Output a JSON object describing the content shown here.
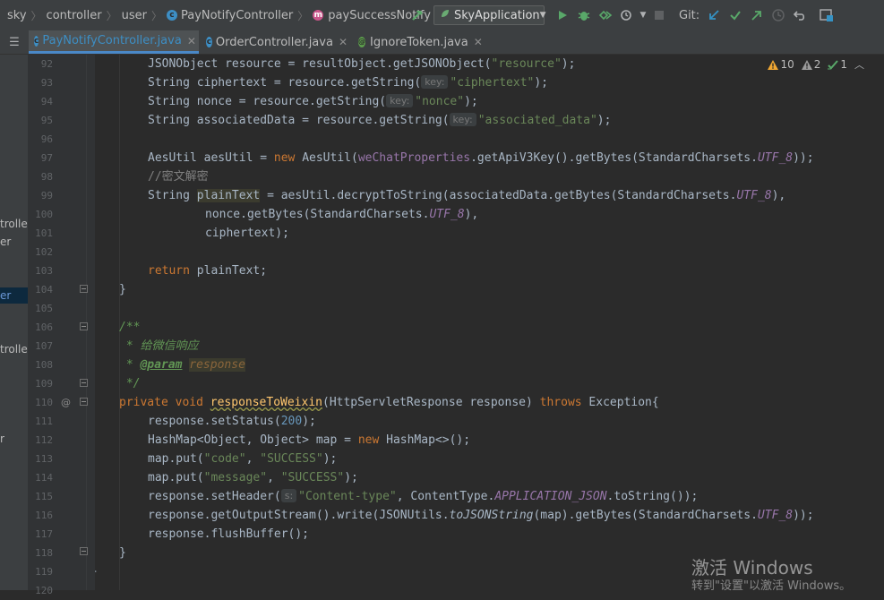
{
  "breadcrumb": {
    "items": [
      "sky",
      "controller",
      "user",
      "PayNotifyController",
      "paySuccessNotify"
    ]
  },
  "toolbar": {
    "run_config": "SkyApplication",
    "git_label": "Git:"
  },
  "tabs": [
    {
      "label": "PayNotifyController.java",
      "active": true
    },
    {
      "label": "OrderController.java",
      "active": false
    },
    {
      "label": "IgnoreToken.java",
      "active": false
    }
  ],
  "inspections": {
    "warnings": "10",
    "weak_warnings": "2",
    "typos": "1"
  },
  "project_panel": [
    "troller",
    "er",
    "er",
    "troller",
    "r"
  ],
  "line_numbers": [
    "92",
    "93",
    "94",
    "95",
    "96",
    "97",
    "98",
    "99",
    "100",
    "101",
    "102",
    "103",
    "104",
    "105",
    "106",
    "107",
    "108",
    "109",
    "110",
    "111",
    "112",
    "113",
    "114",
    "115",
    "116",
    "117",
    "118",
    "119",
    "120"
  ],
  "code": {
    "l92_a": "JSONObject resource = resultObject.getJSONObject(",
    "l92_s": "\"resource\"",
    "l92_b": ");",
    "l93_a": "String ciphertext = resource.getString(",
    "l93_h": "key:",
    "l93_s": "\"ciphertext\"",
    "l93_b": ");",
    "l94_a": "String nonce = resource.getString(",
    "l94_h": "key:",
    "l94_s": "\"nonce\"",
    "l94_b": ");",
    "l95_a": "String associatedData = resource.getString(",
    "l95_h": "key:",
    "l95_s": "\"associated_data\"",
    "l95_b": ");",
    "l97_a": "AesUtil aesUtil = ",
    "l97_kw": "new",
    "l97_b": " AesUtil(",
    "l97_f": "weChatProperties",
    "l97_c": ".getApiV3Key().getBytes(StandardCharsets.",
    "l97_u": "UTF_8",
    "l97_d": "));",
    "l98": "//密文解密",
    "l99_a": "String ",
    "l99_v": "plainText",
    "l99_b": " = aesUtil.decryptToString(associatedData.getBytes(StandardCharsets.",
    "l99_u": "UTF_8",
    "l99_c": "),",
    "l100_a": "nonce.getBytes(StandardCharsets.",
    "l100_u": "UTF_8",
    "l100_b": "),",
    "l101": "ciphertext);",
    "l103_kw": "return",
    "l103_b": " plainText;",
    "l104": "}",
    "l106": "/**",
    "l107": " * 给微信响应",
    "l108_a": " * ",
    "l108_tag": "@param",
    "l108_p": "response",
    "l109": " */",
    "l110_kw1": "private",
    "l110_kw2": "void",
    "l110_m": "responseToWeixin",
    "l110_b": "(HttpServletResponse response) ",
    "l110_kw3": "throws",
    "l110_c": " Exception{",
    "l111_a": "response.setStatus(",
    "l111_n": "200",
    "l111_b": ");",
    "l112_a": "HashMap<Object, Object> map = ",
    "l112_kw": "new",
    "l112_b": " HashMap<>();",
    "l113_a": "map.put(",
    "l113_s1": "\"code\"",
    "l113_m": ", ",
    "l113_s2": "\"SUCCESS\"",
    "l113_b": ");",
    "l114_a": "map.put(",
    "l114_s1": "\"message\"",
    "l114_m": ", ",
    "l114_s2": "\"SUCCESS\"",
    "l114_b": ");",
    "l115_a": "response.setHeader(",
    "l115_h": "s:",
    "l115_s": "\"Content-type\"",
    "l115_b": ", ContentType.",
    "l115_f": "APPLICATION_JSON",
    "l115_c": ".toString());",
    "l116_a": "response.getOutputStream().write(JSONUtils.",
    "l116_i": "toJSONString",
    "l116_b": "(map).getBytes(StandardCharsets.",
    "l116_u": "UTF_8",
    "l116_c": "));",
    "l117": "response.flushBuffer();",
    "l118": "}",
    "l119": "}"
  },
  "watermark": {
    "line1": "激活 Windows",
    "line2": "转到\"设置\"以激活 Windows。"
  },
  "colors": {
    "keyword": "#cc7832",
    "string": "#6a8759",
    "number": "#6897bb",
    "field": "#9876aa",
    "method": "#ffc66d",
    "comment": "#808080",
    "doc": "#629755",
    "background": "#2b2b2b"
  }
}
